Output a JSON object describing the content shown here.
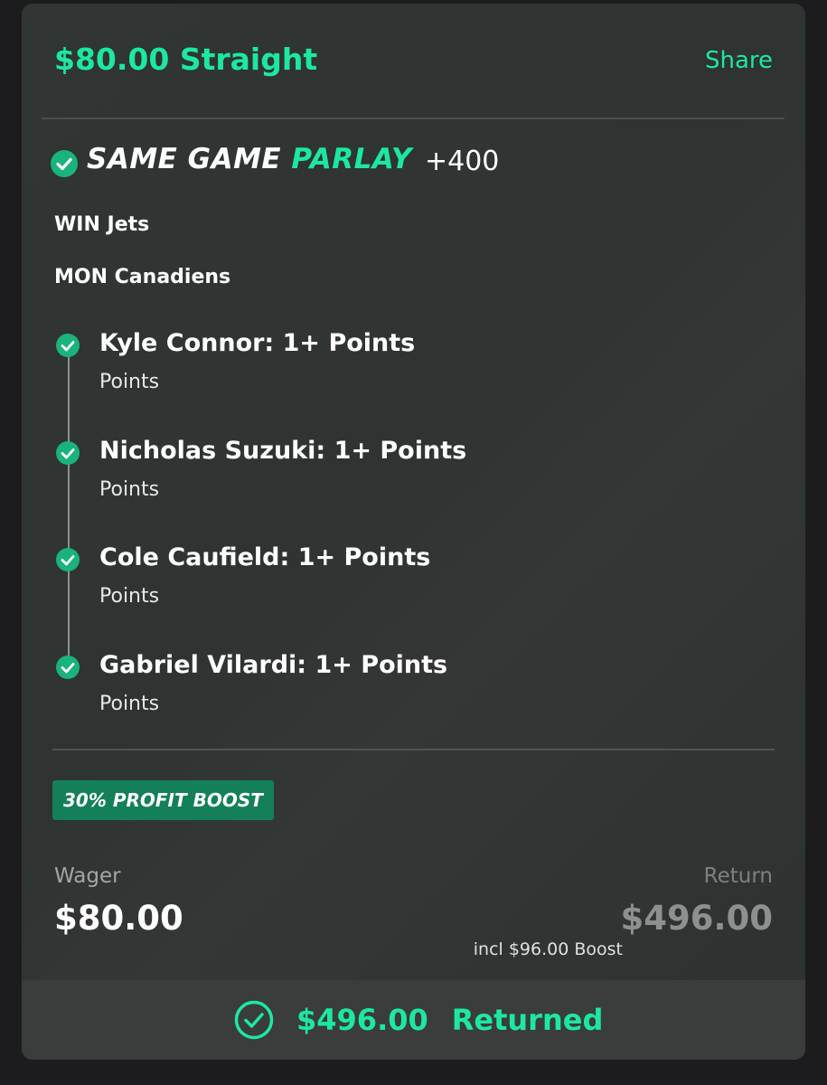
{
  "header": {
    "title": "$80.00 Straight",
    "share_label": "Share"
  },
  "parlay": {
    "title_part1": "SAME GAME ",
    "title_part2": "PARLAY",
    "odds": "+400",
    "teams": [
      "WIN Jets",
      "MON Canadiens"
    ],
    "legs": [
      {
        "name": "Kyle Connor: 1+ Points",
        "market": "Points",
        "status": "won"
      },
      {
        "name": "Nicholas Suzuki: 1+ Points",
        "market": "Points",
        "status": "won"
      },
      {
        "name": "Cole Caufield: 1+ Points",
        "market": "Points",
        "status": "won"
      },
      {
        "name": "Gabriel Vilardi: 1+ Points",
        "market": "Points",
        "status": "won"
      }
    ]
  },
  "boost": {
    "badge": "30% PROFIT BOOST",
    "note": "incl $96.00 Boost"
  },
  "wager": {
    "label": "Wager",
    "value": "$80.00"
  },
  "return": {
    "label": "Return",
    "value": "$496.00"
  },
  "footer": {
    "amount": "$496.00",
    "status": "Returned"
  },
  "colors": {
    "accent": "#1ce8a0",
    "check": "#1ab37c",
    "badge": "#13805a"
  }
}
